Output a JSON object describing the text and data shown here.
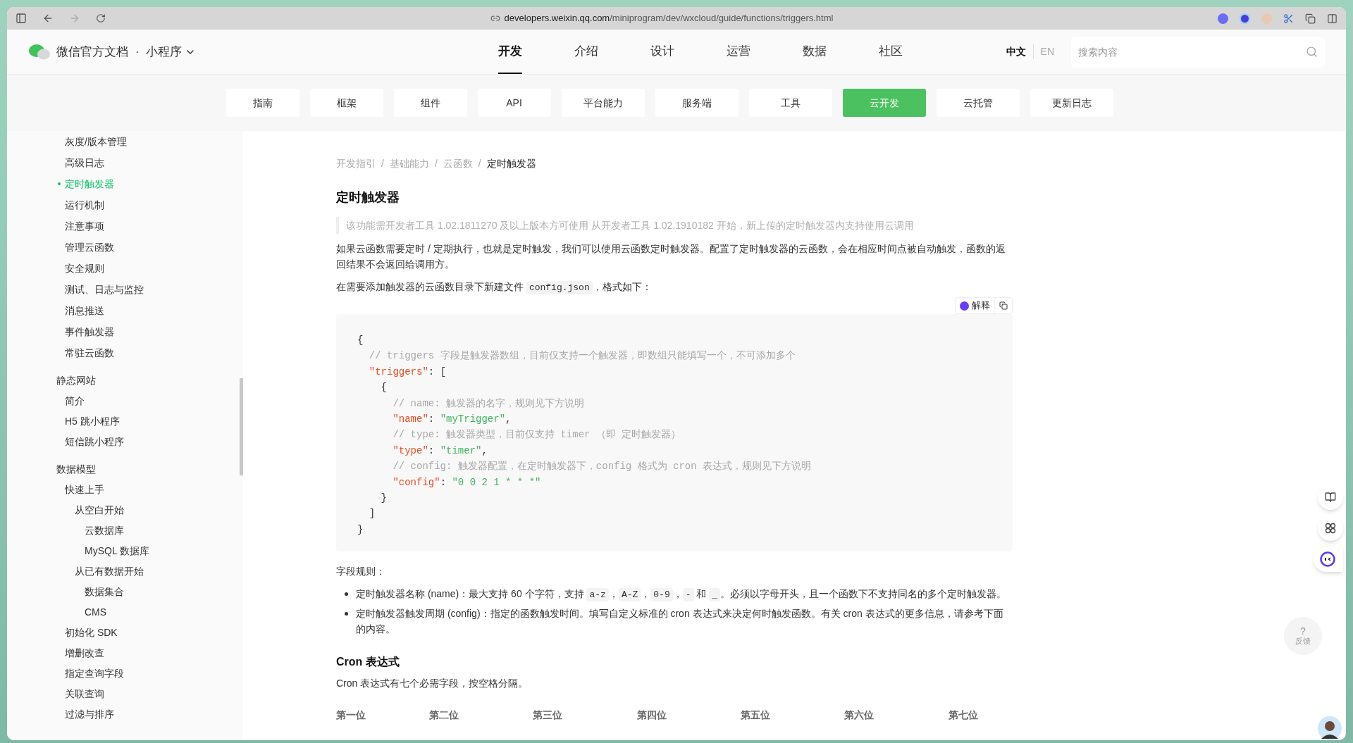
{
  "browser": {
    "url_host": "developers.weixin.qq.com",
    "url_path": "/miniprogram/dev/wxcloud/guide/functions/triggers.html"
  },
  "header": {
    "brand": "微信官方文档",
    "separator": "·",
    "product": "小程序",
    "nav": [
      {
        "label": "开发",
        "selected": true
      },
      {
        "label": "介绍",
        "selected": false
      },
      {
        "label": "设计",
        "selected": false
      },
      {
        "label": "运营",
        "selected": false
      },
      {
        "label": "数据",
        "selected": false
      },
      {
        "label": "社区",
        "selected": false
      }
    ],
    "languages": [
      {
        "label": "中文",
        "selected": true
      },
      {
        "label": "EN",
        "selected": false
      }
    ],
    "search": {
      "placeholder": "搜索内容"
    }
  },
  "subnav": [
    {
      "label": "指南",
      "selected": false
    },
    {
      "label": "框架",
      "selected": false
    },
    {
      "label": "组件",
      "selected": false
    },
    {
      "label": "API",
      "selected": false
    },
    {
      "label": "平台能力",
      "selected": false
    },
    {
      "label": "服务端",
      "selected": false
    },
    {
      "label": "工具",
      "selected": false
    },
    {
      "label": "云开发",
      "selected": true
    },
    {
      "label": "云托管",
      "selected": false
    },
    {
      "label": "更新日志",
      "selected": false
    }
  ],
  "sidebar": {
    "continued_items": [
      {
        "label": "灰度/版本管理",
        "selected": false
      },
      {
        "label": "高级日志",
        "selected": false
      },
      {
        "label": "定时触发器",
        "selected": true
      },
      {
        "label": "运行机制",
        "selected": false
      },
      {
        "label": "注意事项",
        "selected": false
      },
      {
        "label": "管理云函数",
        "selected": false
      },
      {
        "label": "安全规则",
        "selected": false
      },
      {
        "label": "测试、日志与监控",
        "selected": false
      },
      {
        "label": "消息推送",
        "selected": false
      },
      {
        "label": "事件触发器",
        "selected": false
      },
      {
        "label": "常驻云函数",
        "selected": false
      }
    ],
    "sections": [
      {
        "label": "静态网站",
        "selected": false,
        "children": [
          {
            "label": "简介",
            "selected": false
          },
          {
            "label": "H5 跳小程序",
            "selected": false
          },
          {
            "label": "短信跳小程序",
            "selected": false
          }
        ]
      },
      {
        "label": "数据模型",
        "selected": false,
        "children": [
          {
            "label": "快速上手",
            "selected": false,
            "children": [
              {
                "label": "从空白开始",
                "selected": false,
                "children": [
                  {
                    "label": "云数据库",
                    "selected": false
                  },
                  {
                    "label": "MySQL 数据库",
                    "selected": false
                  }
                ]
              },
              {
                "label": "从已有数据开始",
                "selected": false,
                "children": [
                  {
                    "label": "数据集合",
                    "selected": false
                  },
                  {
                    "label": "CMS",
                    "selected": false
                  }
                ]
              }
            ]
          },
          {
            "label": "初始化 SDK",
            "selected": false
          },
          {
            "label": "增删改查",
            "selected": false
          },
          {
            "label": "指定查询字段",
            "selected": false
          },
          {
            "label": "关联查询",
            "selected": false
          },
          {
            "label": "过滤与排序",
            "selected": false
          }
        ]
      }
    ]
  },
  "article": {
    "breadcrumb": [
      {
        "label": "开发指引",
        "current": false
      },
      {
        "label": "基础能力",
        "current": false
      },
      {
        "label": "云函数",
        "current": false
      },
      {
        "label": "定时触发器",
        "current": true
      }
    ],
    "breadcrumb_separator": "/",
    "title": "定时触发器",
    "note": "该功能需开发者工具 1.02.1811270 及以上版本方可使用 从开发者工具 1.02.1910182 开始，新上传的定时触发器内支持使用云调用",
    "intro": "如果云函数需要定时 / 定期执行，也就是定时触发，我们可以使用云函数定时触发器。配置了定时触发器的云函数，会在相应时间点被自动触发，函数的返回结果不会返回给调用方。",
    "file_line": [
      {
        "kind": "text",
        "text": "在需要添加触发器的云函数目录下新建文件 "
      },
      {
        "kind": "code",
        "text": "config.json"
      },
      {
        "kind": "text",
        "text": "，格式如下："
      }
    ],
    "code_actions": {
      "explain": "解释"
    },
    "code": [
      [
        {
          "kind": "punct",
          "text": "{"
        }
      ],
      [
        {
          "kind": "comment",
          "text": "  // triggers 字段是触发器数组，目前仅支持一个触发器，即数组只能填写一个，不可添加多个"
        }
      ],
      [
        {
          "kind": "key",
          "text": "  \"triggers\""
        },
        {
          "kind": "punct",
          "text": ": ["
        }
      ],
      [
        {
          "kind": "punct",
          "text": "    {"
        }
      ],
      [
        {
          "kind": "comment",
          "text": "      // name: 触发器的名字，规则见下方说明"
        }
      ],
      [
        {
          "kind": "key",
          "text": "      \"name\""
        },
        {
          "kind": "punct",
          "text": ": "
        },
        {
          "kind": "string",
          "text": "\"myTrigger\""
        },
        {
          "kind": "punct",
          "text": ","
        }
      ],
      [
        {
          "kind": "comment",
          "text": "      // type: 触发器类型，目前仅支持 timer （即 定时触发器）"
        }
      ],
      [
        {
          "kind": "key",
          "text": "      \"type\""
        },
        {
          "kind": "punct",
          "text": ": "
        },
        {
          "kind": "string",
          "text": "\"timer\""
        },
        {
          "kind": "punct",
          "text": ","
        }
      ],
      [
        {
          "kind": "comment",
          "text": "      // config: 触发器配置，在定时触发器下，config 格式为 cron 表达式，规则见下方说明"
        }
      ],
      [
        {
          "kind": "key",
          "text": "      \"config\""
        },
        {
          "kind": "punct",
          "text": ": "
        },
        {
          "kind": "string",
          "text": "\"0 0 2 1 * * *\""
        }
      ],
      [
        {
          "kind": "punct",
          "text": "    }"
        }
      ],
      [
        {
          "kind": "punct",
          "text": "  ]"
        }
      ],
      [
        {
          "kind": "punct",
          "text": "}"
        }
      ]
    ],
    "rules_title": "字段规则：",
    "rules": [
      [
        {
          "kind": "text",
          "text": "定时触发器名称 (name)：最大支持 60 个字符，支持 "
        },
        {
          "kind": "code",
          "text": "a-z"
        },
        {
          "kind": "text",
          "text": "，"
        },
        {
          "kind": "code",
          "text": "A-Z"
        },
        {
          "kind": "text",
          "text": "，"
        },
        {
          "kind": "code",
          "text": "0-9"
        },
        {
          "kind": "text",
          "text": "，"
        },
        {
          "kind": "code",
          "text": "-"
        },
        {
          "kind": "text",
          "text": " 和 "
        },
        {
          "kind": "code",
          "text": "_"
        },
        {
          "kind": "text",
          "text": "。必须以字母开头，且一个函数下不支持同名的多个定时触发器。"
        }
      ],
      [
        {
          "kind": "text",
          "text": "定时触发器触发周期 (config)：指定的函数触发时间。填写自定义标准的 cron 表达式来决定何时触发函数。有关 cron 表达式的更多信息，请参考下面的内容。"
        }
      ]
    ],
    "cron_title": "Cron 表达式",
    "cron_intro": "Cron 表达式有七个必需字段，按空格分隔。",
    "table": {
      "columns": [
        "第一位",
        "第二位",
        "第三位",
        "第四位",
        "第五位",
        "第六位",
        "第七位"
      ]
    }
  },
  "feedback": {
    "icon": "?",
    "label": "反馈"
  }
}
